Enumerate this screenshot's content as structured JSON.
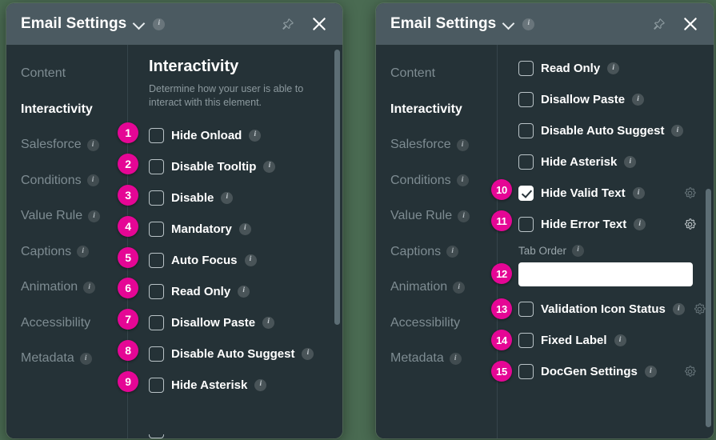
{
  "background_color": "#4a6b52",
  "accent_badge_color": "#e50695",
  "panel_bg": "#253237",
  "titlebar_bg": "#4b5a61",
  "window": {
    "title": "Email Settings",
    "dropdown_icon": "chevron-down-icon",
    "info_icon": "info-icon",
    "pin_icon": "pin-icon",
    "close_icon": "close-icon"
  },
  "sidebar": {
    "items": [
      {
        "label": "Content",
        "active": false,
        "info": false
      },
      {
        "label": "Interactivity",
        "active": true,
        "info": false
      },
      {
        "label": "Salesforce",
        "active": false,
        "info": true
      },
      {
        "label": "Conditions",
        "active": false,
        "info": true
      },
      {
        "label": "Value Rule",
        "active": false,
        "info": true
      },
      {
        "label": "Captions",
        "active": false,
        "info": true
      },
      {
        "label": "Animation",
        "active": false,
        "info": true
      },
      {
        "label": "Accessibility",
        "active": false,
        "info": false
      },
      {
        "label": "Metadata",
        "active": false,
        "info": true
      }
    ]
  },
  "left_panel": {
    "section_title": "Interactivity",
    "section_description": "Determine how your user is able to interact with this element.",
    "options": [
      {
        "badge": "1",
        "label": "Hide Onload",
        "checked": false,
        "info": true,
        "gear": false
      },
      {
        "badge": "2",
        "label": "Disable Tooltip",
        "checked": false,
        "info": true,
        "gear": false
      },
      {
        "badge": "3",
        "label": "Disable",
        "checked": false,
        "info": true,
        "gear": false
      },
      {
        "badge": "4",
        "label": "Mandatory",
        "checked": false,
        "info": true,
        "gear": false
      },
      {
        "badge": "5",
        "label": "Auto Focus",
        "checked": false,
        "info": true,
        "gear": false
      },
      {
        "badge": "6",
        "label": "Read Only",
        "checked": false,
        "info": true,
        "gear": false
      },
      {
        "badge": "7",
        "label": "Disallow Paste",
        "checked": false,
        "info": true,
        "gear": false
      },
      {
        "badge": "8",
        "label": "Disable Auto Suggest",
        "checked": false,
        "info": true,
        "gear": false
      },
      {
        "badge": "9",
        "label": "Hide Asterisk",
        "checked": false,
        "info": true,
        "gear": false
      }
    ]
  },
  "right_panel": {
    "options_top": [
      {
        "badge": "",
        "label": "Read Only",
        "checked": false,
        "info": true,
        "gear": false
      },
      {
        "badge": "",
        "label": "Disallow Paste",
        "checked": false,
        "info": true,
        "gear": false
      },
      {
        "badge": "",
        "label": "Disable Auto Suggest",
        "checked": false,
        "info": true,
        "gear": false
      },
      {
        "badge": "",
        "label": "Hide Asterisk",
        "checked": false,
        "info": true,
        "gear": false
      },
      {
        "badge": "10",
        "label": "Hide Valid Text",
        "checked": true,
        "info": true,
        "gear": true
      },
      {
        "badge": "11",
        "label": "Hide Error Text",
        "checked": false,
        "info": true,
        "gear": true
      }
    ],
    "tab_order": {
      "badge": "12",
      "label": "Tab Order",
      "value": "",
      "placeholder": "",
      "info": true
    },
    "options_bottom": [
      {
        "badge": "13",
        "label": "Validation Icon Status",
        "checked": false,
        "info": true,
        "gear": true
      },
      {
        "badge": "14",
        "label": "Fixed Label",
        "checked": false,
        "info": true,
        "gear": false
      },
      {
        "badge": "15",
        "label": "DocGen Settings",
        "checked": false,
        "info": true,
        "gear": true
      }
    ]
  }
}
